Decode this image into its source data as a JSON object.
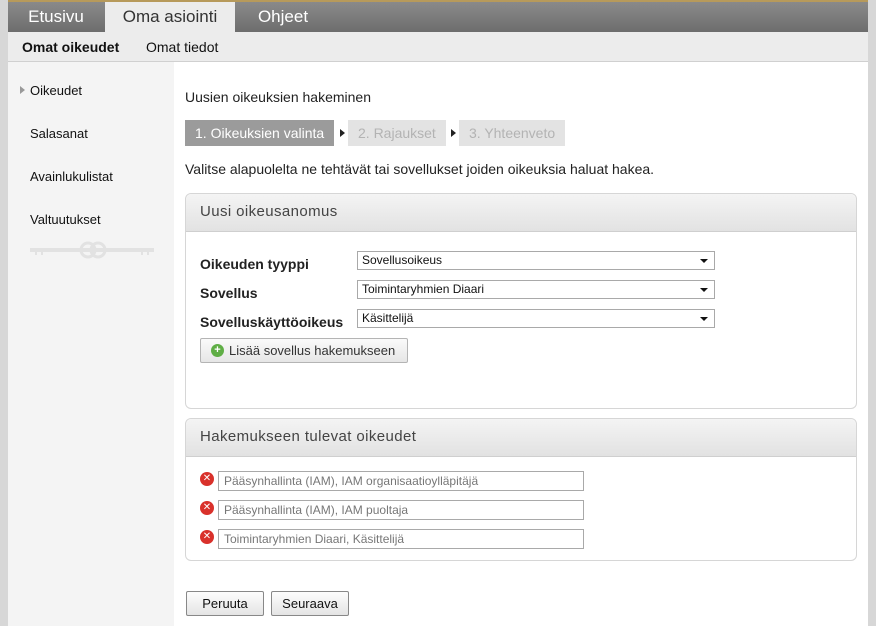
{
  "top_tabs": [
    "Etusivu",
    "Oma asiointi",
    "Ohjeet"
  ],
  "sub_nav": [
    "Omat oikeudet",
    "Omat tiedot"
  ],
  "sidebar": {
    "items": [
      "Oikeudet",
      "Salasanat",
      "Avainlukulistat",
      "Valtuutukset"
    ],
    "decor_icon": "key-icon"
  },
  "main": {
    "heading": "Uusien oikeuksien hakeminen",
    "steps": [
      "1. Oikeuksien valinta",
      "2. Rajaukset",
      "3. Yhteenveto"
    ],
    "intro": "Valitse alapuolelta ne tehtävät tai sovellukset joiden oikeuksia haluat hakea."
  },
  "request_panel": {
    "title": "Uusi oikeusanomus",
    "fields": [
      {
        "label": "Oikeuden tyyppi",
        "value": "Sovellusoikeus"
      },
      {
        "label": "Sovellus",
        "value": "Toimintaryhmien Diaari"
      },
      {
        "label": "Sovelluskäyttöoikeus",
        "value": "Käsittelijä"
      }
    ],
    "add_button": "Lisää sovellus hakemukseen"
  },
  "rights_panel": {
    "title": "Hakemukseen tulevat oikeudet",
    "items": [
      "Pääsynhallinta (IAM), IAM organisaatioylläpitäjä",
      "Pääsynhallinta (IAM), IAM puoltaja",
      "Toimintaryhmien Diaari, Käsittelijä"
    ]
  },
  "buttons": {
    "cancel": "Peruuta",
    "next": "Seuraava"
  },
  "colors": {
    "active_step": "#9b9b9b",
    "remove_icon": "#d9312b",
    "add_icon": "#5fae45"
  }
}
